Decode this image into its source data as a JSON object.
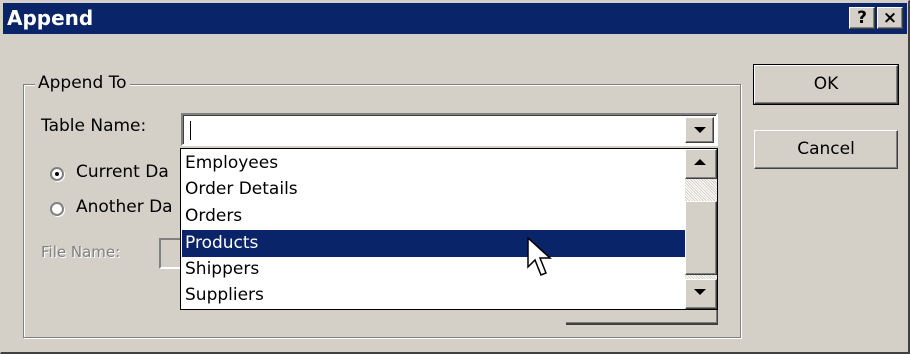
{
  "window": {
    "title": "Append",
    "help_label": "?",
    "close_label": "×"
  },
  "group": {
    "legend": "Append To"
  },
  "table_name": {
    "label": "Table Name:",
    "value": ""
  },
  "radios": [
    {
      "label": "Current Da",
      "checked": true
    },
    {
      "label": "Another Da",
      "checked": false
    }
  ],
  "file_name": {
    "label": "File Name:",
    "enabled": false
  },
  "buttons": {
    "ok": "OK",
    "cancel": "Cancel"
  },
  "dropdown": {
    "items": [
      "Employees",
      "Order Details",
      "Orders",
      "Products",
      "Shippers",
      "Suppliers"
    ],
    "selected_index": 3
  },
  "icons": {
    "dropdown_arrow": "chevron-down-icon",
    "scroll_up": "scroll-up-icon",
    "scroll_down": "scroll-down-icon",
    "cursor": "mouse-pointer-icon"
  },
  "colors": {
    "titlebar": "#0a246a",
    "face": "#d4d0c8",
    "selection": "#0a246a"
  }
}
